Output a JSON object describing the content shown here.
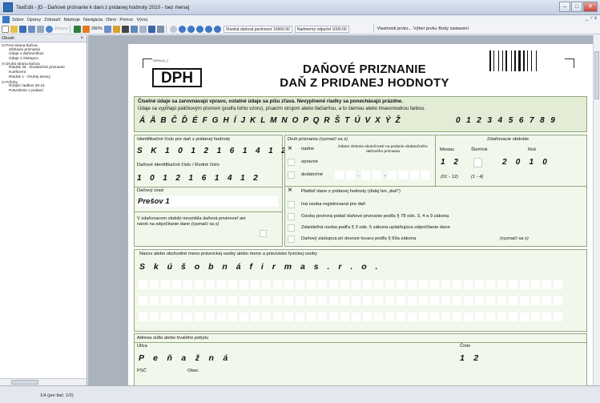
{
  "titlebar": {
    "title": "TaxEdit - [D - Daňové priznanie k dani z pridanej hodnoty 2010 - bez mena]"
  },
  "menu": {
    "items": [
      "Súbor",
      "Úpravy",
      "Zobraziť",
      "Nástroje",
      "Navigácia",
      "Okno",
      "Pomoc",
      "Vývoj"
    ],
    "right": "_ ♂ x"
  },
  "toolbar": {
    "zoom": "280%",
    "back": "Zmeny",
    "field1": "Vlastná daňová povinnosť 19000.00",
    "field2": "Nadmerný odpočet 1000.00",
    "field3": "Vlastnosti prvku...",
    "field4": "Výber prvku",
    "field5": "Body zastavení"
  },
  "sidebar": {
    "title": "Obsah",
    "close": "×",
    "tree": [
      {
        "label": "Prvá strana tlačiva",
        "level": 0
      },
      {
        "label": "Záhlavie priznania",
        "level": 1
      },
      {
        "label": "Údaje o daňovníkovi",
        "level": 1
      },
      {
        "label": "Údaje o zástupcu",
        "level": 1
      },
      {
        "label": "Druhá strana tlačiva",
        "level": 0
      },
      {
        "label": "Riadok 36 - Dodatočné priznanie",
        "level": 1
      },
      {
        "label": "Koeficient",
        "level": 1
      },
      {
        "label": "Riadok 1 - Druhej strany",
        "level": 1
      },
      {
        "label": "Prílohy",
        "level": 0
      },
      {
        "label": "Rozpis riadkov 20-21",
        "level": 1
      },
      {
        "label": "Potvrdenie o podaní",
        "level": 1
      }
    ]
  },
  "status": {
    "page": "1/4 (pre tlač: 1/2)"
  },
  "form": {
    "code": "DPHv10_1",
    "dph": "DPH",
    "title1": "DAŇOVÉ PRIZNANIE",
    "title2": "DAŇ Z PRIDANEJ HODNOTY",
    "instr_bold": "Číselné údaje sa zarovnávajú vpravo, ostatné údaje sa píšu zľava. Nevyplnené riadky sa ponechávajú prázdne.",
    "instr": "Údaje sa vypĺňajú paličkovým písmom (podľa tohto vzoru), písacím strojom alebo tlačiarňou, a to čiernou alebo tmavomodrou farbou.",
    "alphabet": "Á Ä B Č Ď É F G H Í J K L M N O P Q R Š T Ú V X Ý Ž",
    "digits": "0 1 2 3 4 5 6 7 8 9",
    "ic_dph_label": "Identifikačné číslo pre daň z pridanej hodnoty",
    "ic_dph": "S K 1 0 1 2 1 6 1 4 1 2",
    "dic_label": "Daňové identifikačné číslo / Rodné číslo",
    "dic": "1 0 1 2 1 6 1 4 1 2",
    "urad_label": "Daňový úrad",
    "urad": "Prešov 1",
    "nevznikla": "V zdaňovacom období nevznikla daňová povinnosť ani nárok na odpočítanie dane",
    "nevznikla_tail": "(vyznačí sa x)",
    "druh_label": "Druh priznania",
    "druh_hint": "(vyznačí sa x)",
    "riadne": "riadne",
    "opravne": "opravné",
    "dodatocne": "dodatočné",
    "datum_zistenia": "Dátum zistenia skutočností na podanie dodatočného daňového priznania",
    "obdobie_label": "Zdaňovacie obdobie",
    "mesiac_label": "Mesiac",
    "stvrtrok_label": "Štvrťrok",
    "rok_label": "Rok",
    "mesiac": "1 2",
    "rok": "2 0 1 0",
    "range_m": "(01 - 12)",
    "range_q": "(1 - 4)",
    "platitel": "Platiteľ dane z pridanej hodnoty (ďalej len „daň\")",
    "ina_osoba": "Iná osoba registrovaná pre daň",
    "osoba_povinna": "Osoba povinná podať daňové priznanie podľa § 78 ods. 3, 4 a 9 zákona",
    "zdanitelna": "Zdaniteľná osoba podľa § 3 ods. 5 zákona uplatňujúca odpočítanie dane",
    "zastupca": "Daňový zástupca pri dovoze tovaru podľa § 69a zákona",
    "zastupca_hint": "(vyznačí sa x)",
    "nazov_label": "Názov alebo obchodné meno právnickej osoby alebo meno a priezvisko fyzickej osoby",
    "nazov": "S k ú š o b n á   f i r m a   s . r . o .",
    "adresa_label": "Adresa sídla alebo trvalého pobytu",
    "ulica_label": "Ulica",
    "ulica": "P e ň a ž n á",
    "cislo_label": "Číslo",
    "cislo": "1 2",
    "psc_label": "PSČ",
    "obec_label": "Obec",
    "x": "×"
  }
}
